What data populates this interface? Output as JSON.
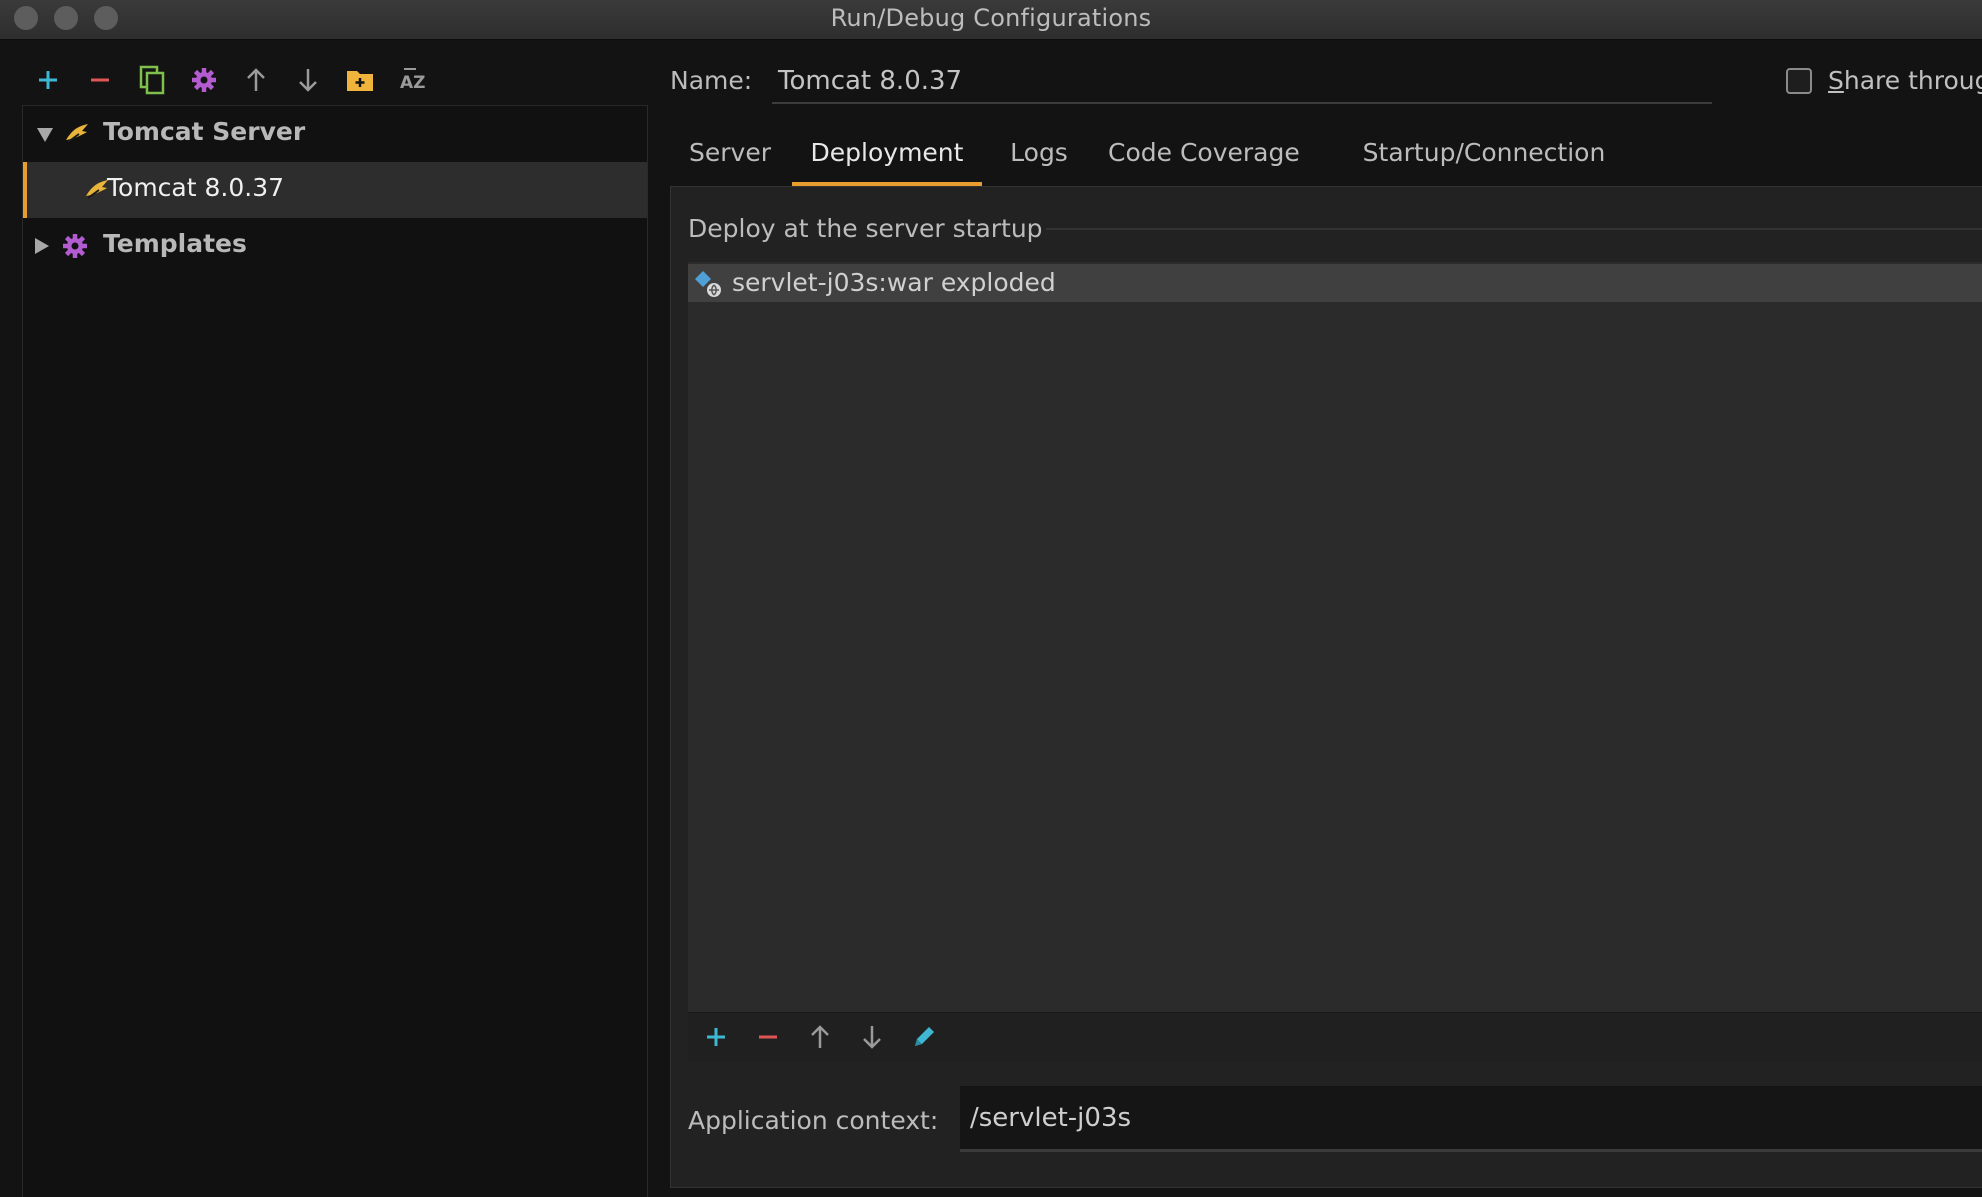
{
  "window": {
    "title": "Run/Debug Configurations"
  },
  "toolbar": {
    "icons": [
      "add-icon",
      "remove-icon",
      "copy-icon",
      "settings-icon",
      "move-up-icon",
      "move-down-icon",
      "new-folder-icon",
      "sort-alpha-icon"
    ]
  },
  "tree": {
    "items": [
      {
        "label": "Tomcat Server",
        "expanded": true
      },
      {
        "label": "Tomcat 8.0.37",
        "selected": true
      },
      {
        "label": "Templates",
        "expanded": false
      }
    ]
  },
  "config": {
    "name_label": "Name:",
    "name_value": "Tomcat 8.0.37",
    "share_label_prefix": "S",
    "share_label_rest": "hare throug",
    "share_checked": false
  },
  "tabs": [
    {
      "label": "Server"
    },
    {
      "label": "Deployment",
      "active": true
    },
    {
      "label": "Logs"
    },
    {
      "label": "Code Coverage"
    },
    {
      "label": "Startup/Connection"
    }
  ],
  "deployment": {
    "section_title": "Deploy at the server startup",
    "items": [
      {
        "label": "servlet-j03s:war exploded"
      }
    ],
    "toolbar_icons": [
      "add-icon",
      "remove-icon",
      "move-up-icon",
      "move-down-icon",
      "edit-icon"
    ],
    "context_label": "Application context:",
    "context_value": "/servlet-j03s"
  },
  "colors": {
    "accent": "#e89e2c",
    "add": "#3fb7d2",
    "remove": "#e05555",
    "copy": "#7fbf4d",
    "gear": "#b35bd1",
    "folder": "#f0b43c"
  }
}
